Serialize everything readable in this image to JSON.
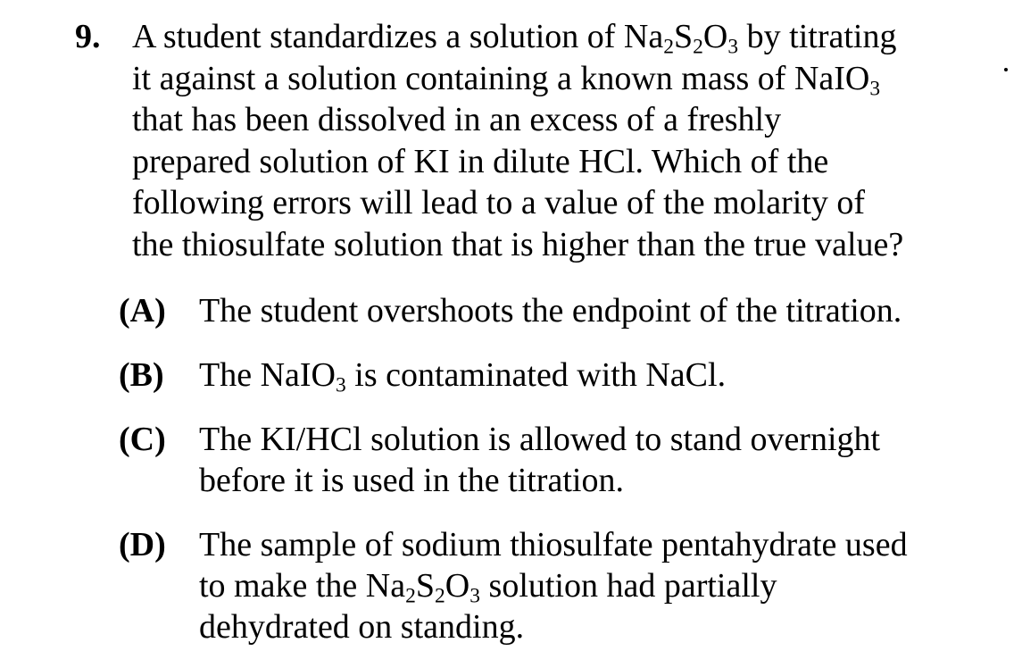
{
  "question": {
    "number": "9.",
    "stem_lines": [
      {
        "parts": [
          "A student standardizes a solution of Na",
          "2",
          "S",
          "2",
          "O",
          "3",
          " by titrating"
        ]
      },
      {
        "parts": [
          "it against a solution containing a known mass of NaIO",
          "3",
          "",
          "",
          "",
          "",
          ""
        ]
      },
      {
        "parts": [
          "that has been dissolved in an excess of a freshly",
          "",
          "",
          "",
          "",
          "",
          ""
        ]
      },
      {
        "parts": [
          "prepared solution of KI in dilute HCl.  Which of the",
          "",
          "",
          "",
          "",
          "",
          ""
        ]
      },
      {
        "parts": [
          "following errors will lead to a value of the molarity of",
          "",
          "",
          "",
          "",
          "",
          ""
        ]
      },
      {
        "parts": [
          "the thiosulfate solution that is higher than the true value?",
          "",
          "",
          "",
          "",
          "",
          ""
        ]
      }
    ]
  },
  "options": [
    {
      "letter": "(A)",
      "lines": [
        {
          "parts": [
            "The student overshoots the endpoint of the titration.",
            "",
            "",
            "",
            "",
            "",
            ""
          ]
        }
      ]
    },
    {
      "letter": "(B)",
      "lines": [
        {
          "parts": [
            "The NaIO",
            "3",
            " is contaminated with NaCl.",
            "",
            "",
            "",
            ""
          ]
        }
      ]
    },
    {
      "letter": "(C)",
      "lines": [
        {
          "parts": [
            "The KI/HCl solution is allowed to stand overnight",
            "",
            "",
            "",
            "",
            "",
            ""
          ]
        },
        {
          "parts": [
            "before it is used in the titration.",
            "",
            "",
            "",
            "",
            "",
            ""
          ]
        }
      ]
    },
    {
      "letter": "(D)",
      "lines": [
        {
          "parts": [
            "The sample of sodium thiosulfate pentahydrate used",
            "",
            "",
            "",
            "",
            "",
            ""
          ]
        },
        {
          "parts": [
            "to make the Na",
            "2",
            "S",
            "2",
            "O",
            "3",
            " solution had partially"
          ]
        },
        {
          "parts": [
            "dehydrated on standing.",
            "",
            "",
            "",
            "",
            "",
            ""
          ]
        }
      ]
    }
  ]
}
